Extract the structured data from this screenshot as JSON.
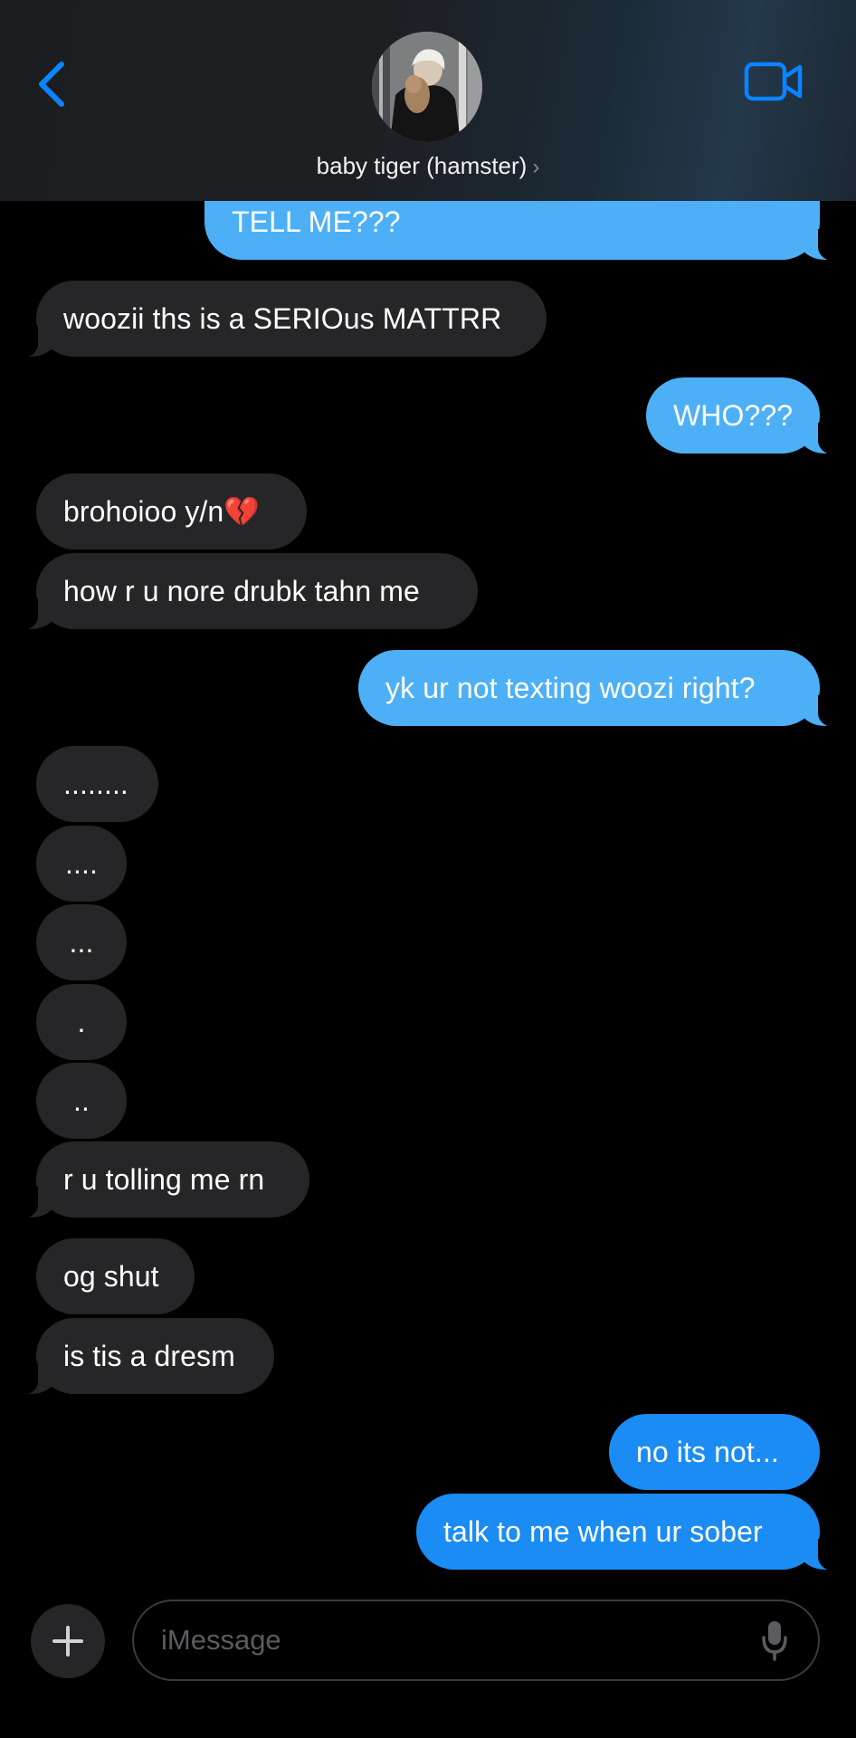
{
  "header": {
    "contact_name": "baby tiger (hamster)",
    "chevron": "›",
    "back_icon": "chevron-left-icon",
    "video_icon": "video-camera-icon"
  },
  "messages": [
    {
      "side": "sent",
      "text": "TELL ME???"
    },
    {
      "side": "received",
      "text": "woozii ths is a SERIOus MATTRR"
    },
    {
      "side": "sent",
      "text": "WHO???"
    },
    {
      "side": "received",
      "text": "brohoioo y/n💔"
    },
    {
      "side": "received",
      "text": "how r u nore drubk tahn me"
    },
    {
      "side": "sent",
      "text": "yk ur not texting woozi right?"
    },
    {
      "side": "received",
      "text": "........"
    },
    {
      "side": "received",
      "text": "...."
    },
    {
      "side": "received",
      "text": "..."
    },
    {
      "side": "received",
      "text": "."
    },
    {
      "side": "received",
      "text": ".."
    },
    {
      "side": "received",
      "text": "r u tolling me rn"
    },
    {
      "side": "received",
      "text": "og shut"
    },
    {
      "side": "received",
      "text": "is tis a dresm"
    },
    {
      "side": "sent",
      "text": "no its not..."
    },
    {
      "side": "sent",
      "text": "talk to me when ur sober"
    }
  ],
  "composer": {
    "placeholder": "iMessage",
    "plus_icon": "plus-icon",
    "mic_icon": "microphone-icon"
  },
  "colors": {
    "sent_light": "#4db0f6",
    "sent_dark": "#1a8cf4",
    "received": "#262628",
    "accent": "#0a84ff"
  }
}
